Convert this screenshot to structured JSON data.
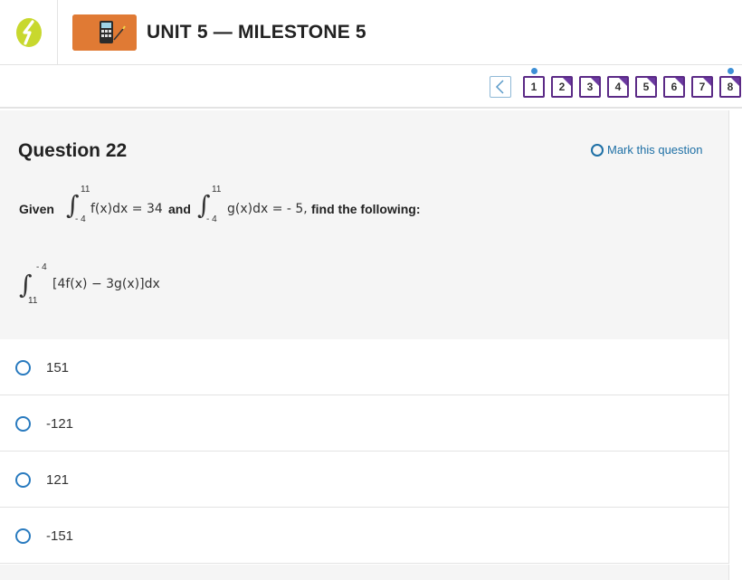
{
  "header": {
    "unit_title": "UNIT 5 — MILESTONE 5"
  },
  "navigator": {
    "prev_icon": "chevron-left-icon",
    "questions": [
      {
        "label": "1",
        "dot": true,
        "corner": false
      },
      {
        "label": "2",
        "dot": false,
        "corner": true
      },
      {
        "label": "3",
        "dot": false,
        "corner": true
      },
      {
        "label": "4",
        "dot": false,
        "corner": true
      },
      {
        "label": "5",
        "dot": false,
        "corner": true
      },
      {
        "label": "6",
        "dot": false,
        "corner": true
      },
      {
        "label": "7",
        "dot": false,
        "corner": true
      },
      {
        "label": "8",
        "dot": true,
        "corner": true
      }
    ]
  },
  "question": {
    "title": "Question 22",
    "mark_label": "Mark this question",
    "given_label": "Given",
    "int1": {
      "upper": "11",
      "lower": "- 4",
      "integrand": "f(x)dx = 34"
    },
    "and_label": "and",
    "int2": {
      "upper": "11",
      "lower": "- 4",
      "integrand": "g(x)dx = - 5,"
    },
    "find_label": "find the following:",
    "int3": {
      "upper": "- 4",
      "lower": "11",
      "integrand": "[4f(x) − 3g(x)]dx"
    }
  },
  "answers": [
    {
      "label": "151"
    },
    {
      "label": "-121"
    },
    {
      "label": "121"
    },
    {
      "label": "-151"
    }
  ],
  "colors": {
    "brand_green": "#c8d82e",
    "nav_purple": "#5b2a86",
    "link_blue": "#1d6fa5",
    "radio_blue": "#2a7bbf"
  }
}
